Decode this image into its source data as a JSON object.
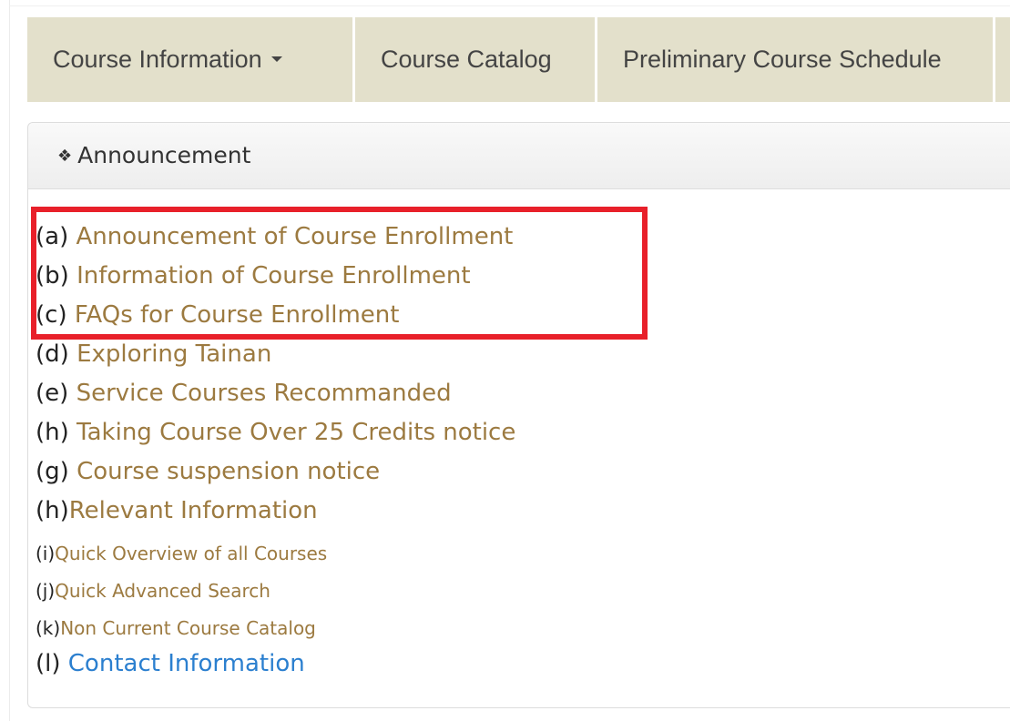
{
  "nav": {
    "tabs": [
      {
        "label": "Course Information"
      },
      {
        "label": "Course Catalog"
      },
      {
        "label": "Preliminary Course Schedule"
      }
    ]
  },
  "panel": {
    "heading": "Announcement",
    "items": [
      {
        "prefix": "(a) ",
        "label": "Announcement of Course Enrollment"
      },
      {
        "prefix": "(b) ",
        "label": "Information of Course Enrollment"
      },
      {
        "prefix": "(c) ",
        "label": "FAQs for Course Enrollment"
      },
      {
        "prefix": "(d) ",
        "label": "Exploring Tainan"
      },
      {
        "prefix": "(e) ",
        "label": "Service Courses Recommanded"
      },
      {
        "prefix": "(h) ",
        "label": "Taking Course Over 25 Credits notice"
      },
      {
        "prefix": "(g) ",
        "label": "Course suspension notice"
      },
      {
        "prefix": "(h)",
        "label": "Relevant Information"
      },
      {
        "prefix": "(i)",
        "label": "Quick Overview of all Courses"
      },
      {
        "prefix": "(j)",
        "label": "Quick Advanced Search"
      },
      {
        "prefix": "(k)",
        "label": "Non Current Course Catalog"
      },
      {
        "prefix": "(l) ",
        "label": "Contact Information"
      }
    ]
  },
  "colors": {
    "nav_bg": "#e3e0cb",
    "link": "#9c7a40",
    "contact_link": "#2b7fcf",
    "highlight": "#e8202a"
  }
}
